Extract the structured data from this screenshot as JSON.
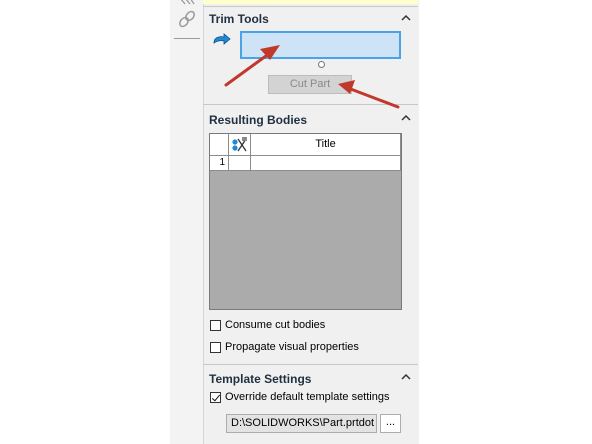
{
  "trim_tools": {
    "title": "Trim Tools",
    "cut_part_label": "Cut Part"
  },
  "resulting_bodies": {
    "title": "Resulting Bodies",
    "columns": [
      "",
      "",
      "Title"
    ],
    "rows": [
      {
        "index": "1",
        "icon": "",
        "title": ""
      }
    ]
  },
  "options": {
    "consume_cut_bodies": {
      "label": "Consume cut bodies",
      "checked": false
    },
    "propagate_visual": {
      "label": "Propagate visual properties",
      "checked": false
    }
  },
  "template_settings": {
    "title": "Template Settings",
    "override": {
      "label": "Override default template settings",
      "checked": true
    },
    "path": "D:\\SOLIDWORKS\\Part.prtdot",
    "browse_label": "..."
  },
  "colors": {
    "selection_fill": "#cfe3f7",
    "selection_border": "#49a3e8",
    "annotation_arrow": "#c0392b"
  }
}
